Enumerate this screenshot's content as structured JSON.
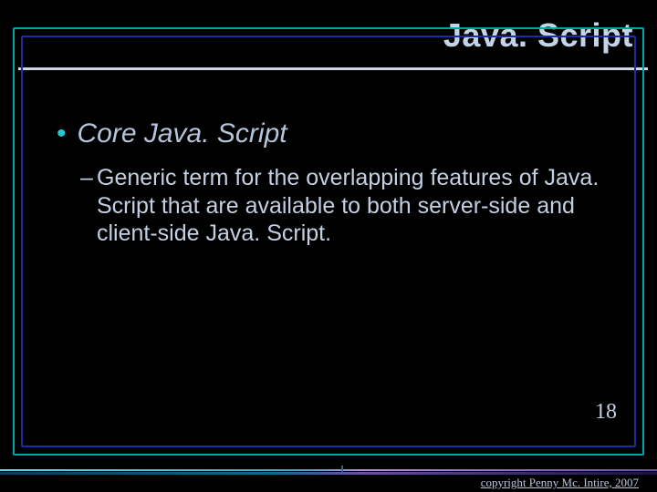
{
  "title": "Java. Script",
  "bullets": {
    "level1": "Core Java. Script",
    "level2": "Generic term for the overlapping features of Java. Script that are available to both server-side and client-side Java. Script."
  },
  "page_number": "18",
  "copyright": "copyright Penny Mc. Intire, 2007"
}
